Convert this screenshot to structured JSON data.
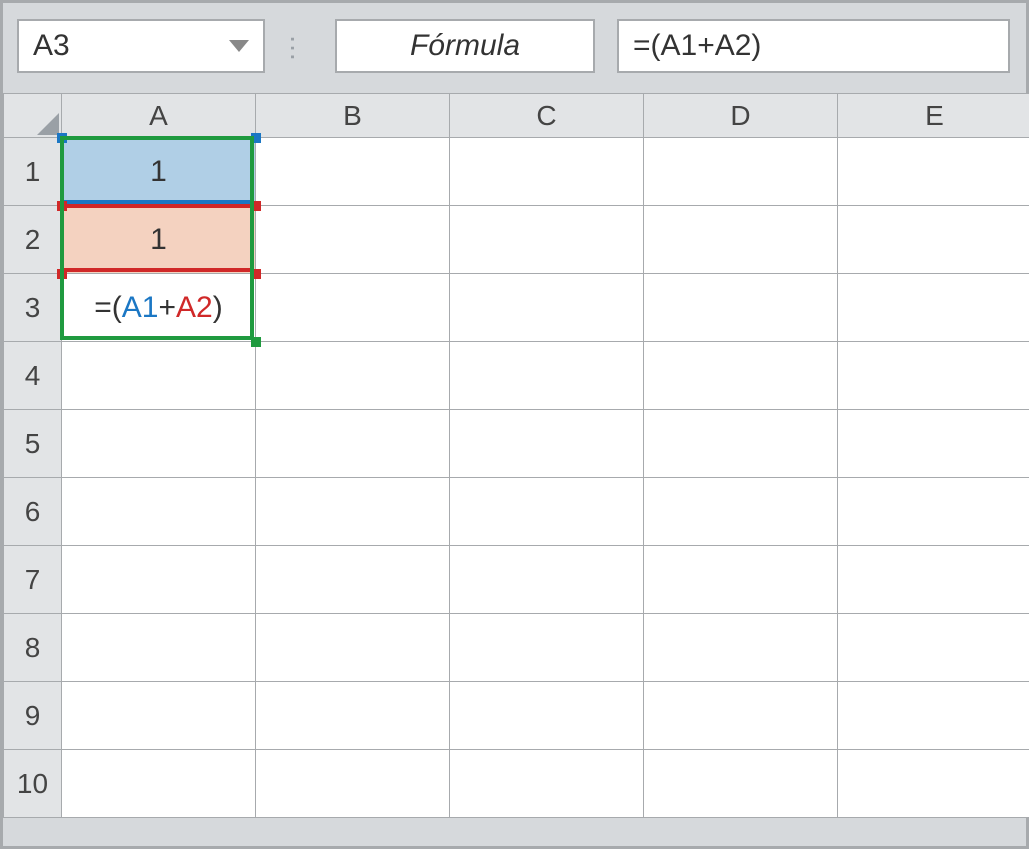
{
  "toolbar": {
    "name_box": "A3",
    "formula_label": "Fórmula",
    "formula_value": "=(A1+A2)"
  },
  "columns": [
    "A",
    "B",
    "C",
    "D",
    "E"
  ],
  "rows": [
    "1",
    "2",
    "3",
    "4",
    "5",
    "6",
    "7",
    "8",
    "9",
    "10"
  ],
  "cells": {
    "A1": "1",
    "A2": "1",
    "A3_formula": {
      "prefix": "=(",
      "ref1": "A1",
      "op": "+",
      "ref2": "A2",
      "suffix": ")"
    }
  },
  "active_cell": "A3",
  "references": {
    "A1": {
      "color": "blue"
    },
    "A2": {
      "color": "red"
    }
  },
  "colors": {
    "blue": "#1b77c4",
    "red": "#d02828",
    "green": "#1f9a3f",
    "blue_fill": "#b0cfe6",
    "orange_fill": "#f4d2c0"
  }
}
